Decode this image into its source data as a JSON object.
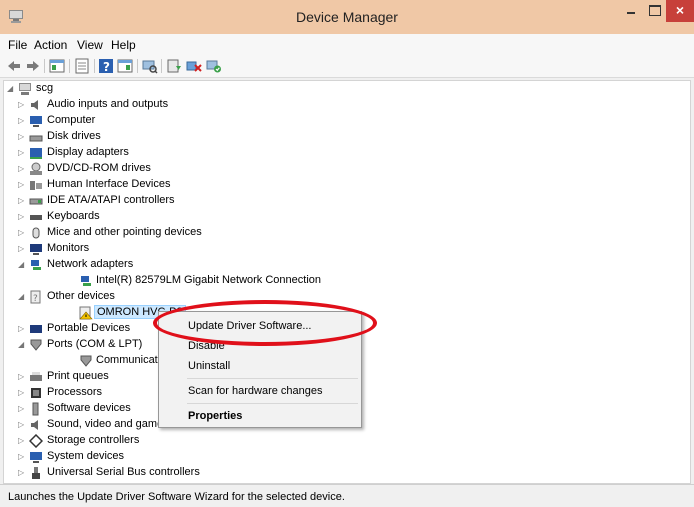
{
  "window": {
    "title": "Device Manager",
    "app_icon": "device-manager-icon",
    "controls": {
      "minimize": "minimize-icon",
      "maximize": "maximize-icon",
      "close_label": "×"
    }
  },
  "menubar": {
    "items": [
      "File",
      "Action",
      "View",
      "Help"
    ]
  },
  "toolbar": {
    "buttons": [
      "back-icon",
      "forward-icon",
      "show-hide-console-tree-icon",
      "properties-icon",
      "help-icon",
      "action-pane-icon",
      "scan-hardware-icon",
      "update-driver-icon",
      "uninstall-icon",
      "enable-device-icon"
    ]
  },
  "tree": {
    "root": "scg",
    "categories": [
      "Audio inputs and outputs",
      "Computer",
      "Disk drives",
      "Display adapters",
      "DVD/CD-ROM drives",
      "Human Interface Devices",
      "IDE ATA/ATAPI controllers",
      "Keyboards",
      "Mice and other pointing devices",
      "Monitors",
      "Network adapters",
      "Intel(R) 82579LM Gigabit Network Connection",
      "Other devices",
      "OMRON HVC-P2",
      "Portable Devices",
      "Ports (COM & LPT)",
      "Communications Port",
      "Print queues",
      "Processors",
      "Software devices",
      "Sound, video and game controllers",
      "Storage controllers",
      "System devices",
      "Universal Serial Bus controllers"
    ]
  },
  "context_menu": {
    "update_driver": "Update Driver Software...",
    "disable": "Disable",
    "uninstall": "Uninstall",
    "scan": "Scan for hardware changes",
    "properties": "Properties"
  },
  "status_bar": {
    "text": "Launches the Update Driver Software Wizard for the selected device."
  },
  "colors": {
    "titlebar": "#f0c8a6",
    "close_button": "#c7403a",
    "annotation_ellipse": "#e0101a",
    "selection": "#cce8ff"
  }
}
